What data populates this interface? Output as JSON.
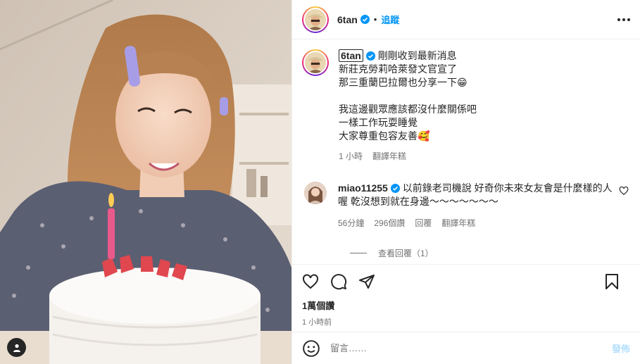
{
  "post": {
    "username": "6tan",
    "follow_label": "追蹤",
    "caption": {
      "username": "6tan",
      "lines": [
        "剛剛收到最新消息",
        "新莊克勞莉哈萊發文官宣了",
        "那三重蘭巴拉爾也分享一下😁",
        "",
        "我這邊觀眾應該都沒什麼關係吧",
        "一樣工作玩耍睡覺",
        "大家尊重包容友善🥰"
      ],
      "time": "1 小時",
      "translate": "翻譯年糕"
    },
    "comment": {
      "username": "miao11255",
      "text": "以前錄老司機說 好奇你未來女友會是什麼樣的人 喔 乾沒想到就在身邊～～～～～～～",
      "time": "56分鐘",
      "likes": "296個讚",
      "reply": "回覆",
      "translate": "翻譯年糕",
      "view_replies": "查看回覆（1）"
    },
    "likes": "1萬個讚",
    "posted": "1 小時前",
    "input_placeholder": "留言……",
    "post_button": "發佈"
  },
  "colors": {
    "accent": "#0095f6",
    "post_disabled": "#b2dffc",
    "muted": "#737373",
    "text": "#262626"
  }
}
